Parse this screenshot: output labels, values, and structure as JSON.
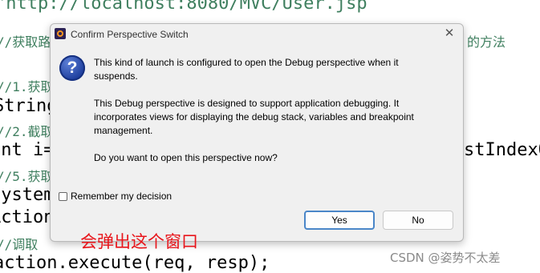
{
  "background_code": {
    "url_line": "\"http://localhost:8080/MVC/User.jsp",
    "top_fragment": "(                    )",
    "comment_get_path": "//获取路",
    "comment_get_path_tail": "的方法",
    "comment_1": "//1.获取",
    "line_string": "String",
    "comment_2": "//2.截取",
    "line_uri": "int i=uri",
    "line_uri_tail": "stIndexO",
    "comment_5": "//5.获取",
    "line_system": "System.",
    "line_action": "Action",
    "comment_call": "//调取",
    "line_execute": "action.execute(req, resp);"
  },
  "dialog": {
    "title": "Confirm Perspective Switch",
    "close_glyph": "✕",
    "question_icon_glyph": "?",
    "message_line1": "This kind of launch is configured to open the Debug perspective when it",
    "message_line2": "suspends.",
    "message_line3": "This Debug perspective is designed to support application debugging.  It",
    "message_line4": "incorporates views for displaying the debug stack, variables and breakpoint",
    "message_line5": "management.",
    "message_line6": "Do you want to open this perspective now?",
    "remember_label": "Remember my decision",
    "remember_checked": false,
    "yes_label": "Yes",
    "no_label": "No"
  },
  "annotation": "会弹出这个窗口",
  "watermark": "CSDN @姿势不太差"
}
